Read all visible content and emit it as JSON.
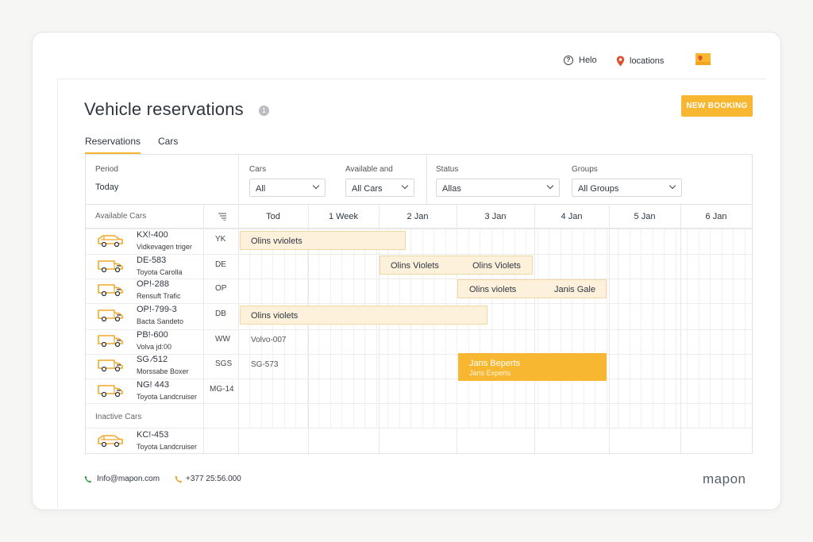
{
  "topbar": {
    "help_label": "Helo",
    "locations_label": "locations"
  },
  "page": {
    "title": "Vehicle reservations",
    "title_badge": "1",
    "new_booking_label": "NEW BOOKING"
  },
  "tabs": [
    {
      "label": "Reservations",
      "active": true
    },
    {
      "label": "Cars",
      "active": false
    }
  ],
  "filters": {
    "period_label": "Period",
    "period_value": "Today",
    "cars_label": "Cars",
    "cars_value": "All",
    "available_label": "Available and",
    "available_value": "All Cars",
    "status_label": "Status",
    "status_value": "Allas",
    "groups_label": "Groups",
    "groups_value": "All Groups"
  },
  "grid": {
    "available_cars_label": "Available Cars",
    "inactive_cars_label": "Inactive Cars",
    "columns": [
      "Tod",
      "1 Week",
      "2 Jan",
      "3 Jan",
      "4 Jan",
      "5 Jan",
      "6 Jan"
    ]
  },
  "cars": [
    {
      "plate": "KX!-400",
      "model": "Vidkevagen triger",
      "code": "YK"
    },
    {
      "plate": "DE-583",
      "model": "Toyota Carolla",
      "code": "DE"
    },
    {
      "plate": "OP!-288",
      "model": "Rensuft Trafic",
      "code": "OP"
    },
    {
      "plate": "OP!-799-3",
      "model": "Bacta Sandeto",
      "code": "DB"
    },
    {
      "plate": "PB!-600",
      "model": "Volva jd:00",
      "code": "WW"
    },
    {
      "plate": "SG ⁄512",
      "model": "Morssabe Boxer",
      "code": "SGS"
    },
    {
      "plate": "NG! 443",
      "model": "Toyota Landcruiser",
      "code": "MG-14"
    }
  ],
  "inactive_cars": [
    {
      "plate": "KC!-453",
      "model": "Toyota Landcruiser"
    }
  ],
  "bookings": {
    "b1": "Olins vviolets",
    "b2a": "Olins Violets",
    "b2b": "Olins Violets",
    "b3a": "Olins violets",
    "b3b": "Janis Gale",
    "b4": "Olins violets",
    "t5": "Volvo-007",
    "t6": "SG-573",
    "b6_title": "Jans Beperts",
    "b6_sub": "Jans Experts"
  },
  "footer": {
    "email": "Info@mapon.com",
    "phone": "+377 25:56.000",
    "brand": "mapon"
  },
  "colors": {
    "accent": "#f7b731",
    "booking_bg": "#fdf1dc",
    "text": "#2f3640"
  }
}
